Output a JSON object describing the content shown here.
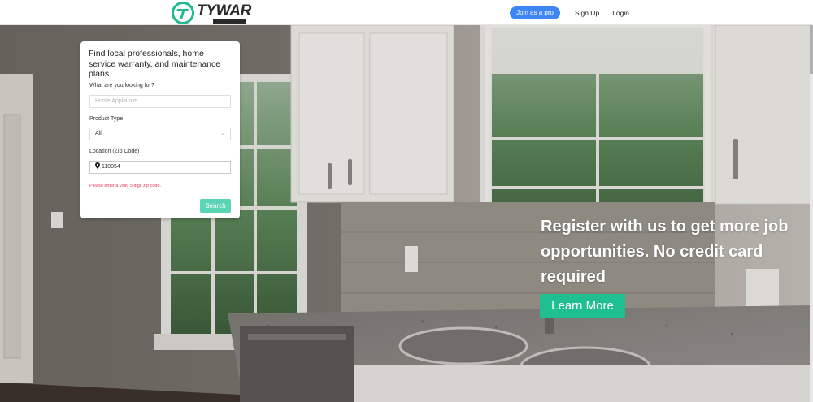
{
  "header": {
    "logo": {
      "word": "TYWAR",
      "sub": "",
      "mark_color": "#21b98f"
    },
    "join_pro_label": "Join as a pro",
    "signup_label": "Sign Up",
    "login_label": "Login"
  },
  "search_card": {
    "title": "Find local professionals, home service warranty, and maintenance plans.",
    "looking_for": {
      "label": "What are you looking for?",
      "placeholder": "Home Appliance",
      "value": ""
    },
    "product_type": {
      "label": "Product Type",
      "value": "All"
    },
    "location": {
      "label": "Location (Zip Code)",
      "value": "110054"
    },
    "error": "Please enter a valid 5 digit zip code.",
    "search_label": "Search"
  },
  "cta": {
    "text": "Register with us to get more job opportunities. No credit card required",
    "button_label": "Learn More"
  },
  "colors": {
    "accent_blue": "#3f86f5",
    "search_button": "#5cd5b6",
    "learn_more_button": "#1fbf91",
    "error": "#e53957"
  }
}
